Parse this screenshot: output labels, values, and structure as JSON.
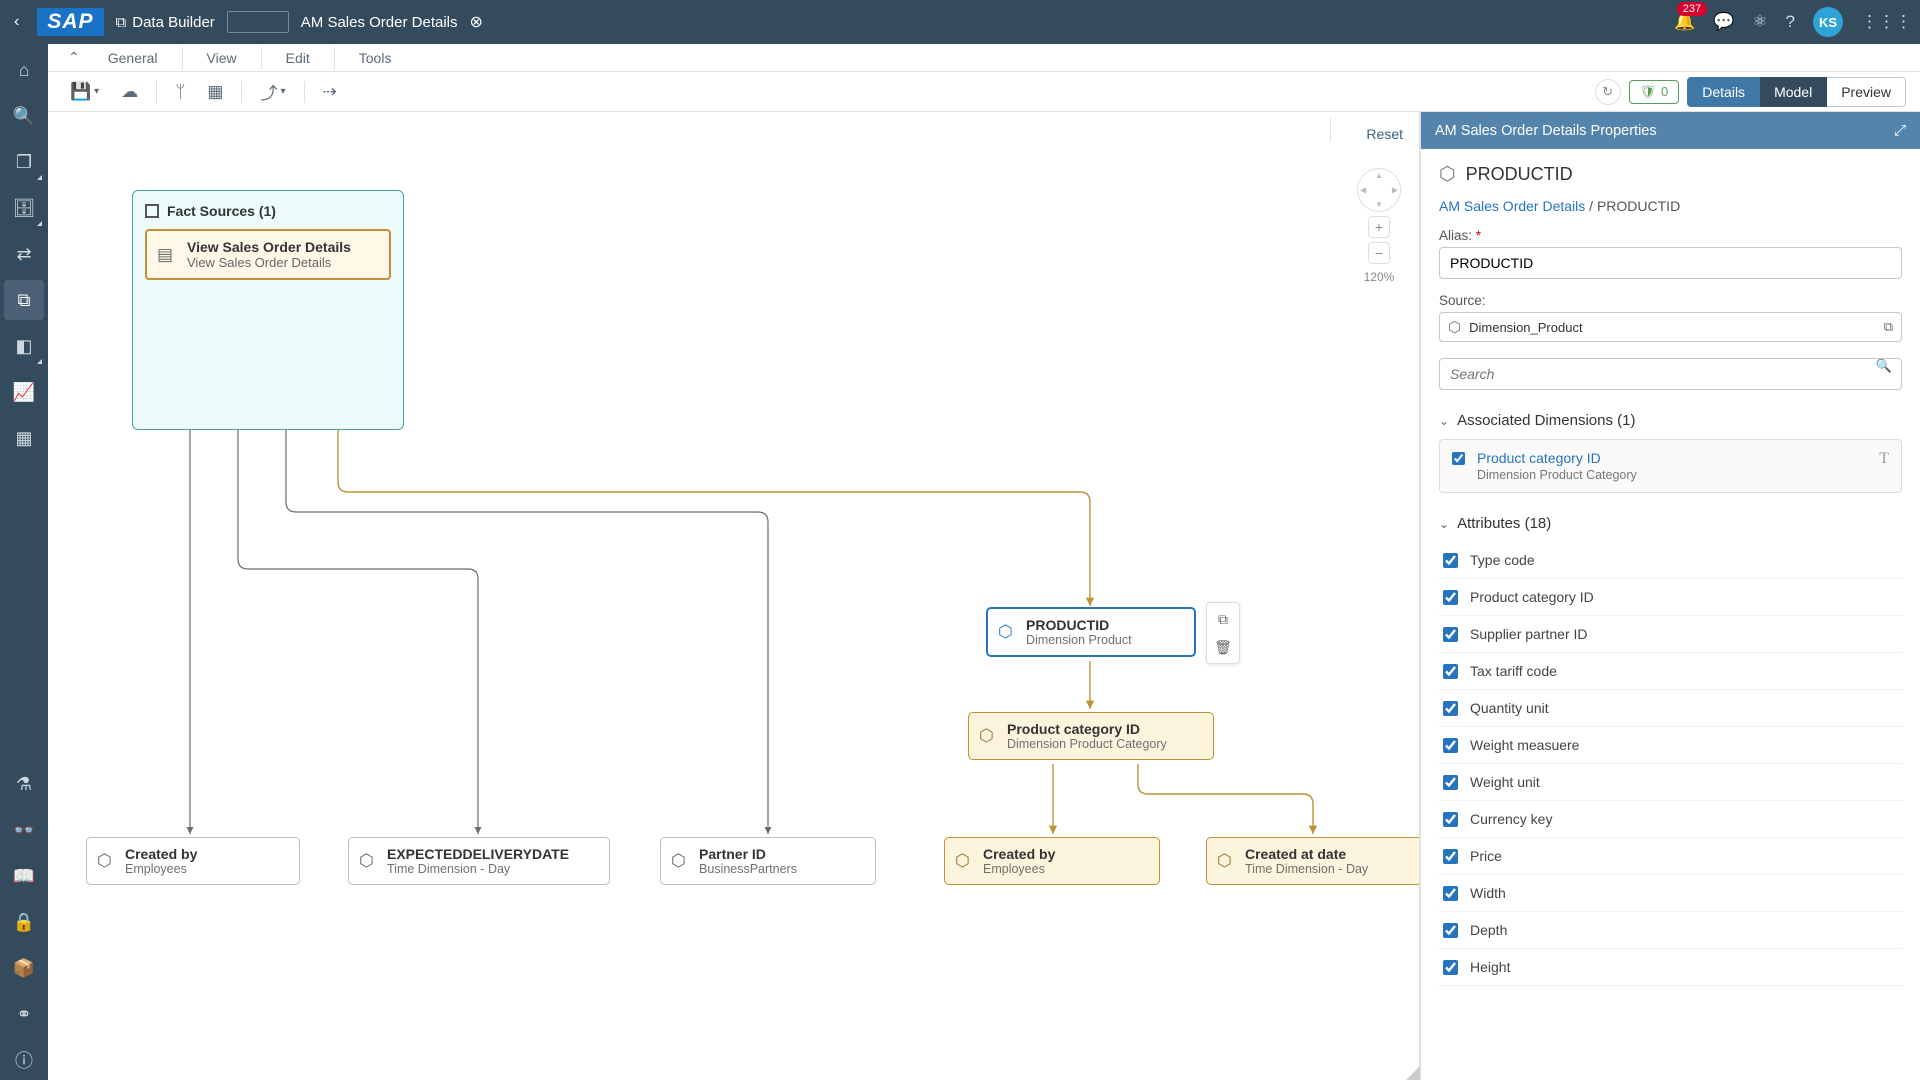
{
  "topbar": {
    "breadcrumb": {
      "app": "Data Builder",
      "title": "AM Sales Order Details"
    },
    "notifications": "237",
    "avatar": "KS"
  },
  "menus": {
    "general": "General",
    "view": "View",
    "edit": "Edit",
    "tools": "Tools"
  },
  "actions": {
    "validation_count": "0",
    "details": "Details",
    "model": "Model",
    "preview": "Preview",
    "reset": "Reset",
    "zoom": "120%"
  },
  "canvas": {
    "fact_group": "Fact Sources (1)",
    "fact_item": {
      "title": "View Sales Order Details",
      "sub": "View Sales Order Details"
    },
    "productid": {
      "title": "PRODUCTID",
      "sub": "Dimension Product"
    },
    "prodcat": {
      "title": "Product category ID",
      "sub": "Dimension Product Category"
    },
    "createdby1": {
      "title": "Created by",
      "sub": "Employees"
    },
    "expdeliv": {
      "title": "EXPECTEDDELIVERYDATE",
      "sub": "Time Dimension - Day"
    },
    "partner": {
      "title": "Partner ID",
      "sub": "BusinessPartners"
    },
    "createdby2": {
      "title": "Created by",
      "sub": "Employees"
    },
    "createdat": {
      "title": "Created at date",
      "sub": "Time Dimension - Day"
    }
  },
  "props": {
    "header": "AM Sales Order Details Properties",
    "title": "PRODUCTID",
    "bc_parent": "AM Sales Order Details",
    "bc_current": "PRODUCTID",
    "alias_label": "Alias:",
    "alias_value": "PRODUCTID",
    "source_label": "Source:",
    "source_value": "Dimension_Product",
    "search_placeholder": "Search",
    "assoc_title": "Associated Dimensions (1)",
    "assoc_item": {
      "name": "Product category ID",
      "sub": "Dimension Product Category"
    },
    "attrs_title": "Attributes (18)",
    "attrs": [
      "Type code",
      "Product category ID",
      "Supplier partner ID",
      "Tax tariff code",
      "Quantity unit",
      "Weight measuere",
      "Weight unit",
      "Currency key",
      "Price",
      "Width",
      "Depth",
      "Height"
    ]
  }
}
